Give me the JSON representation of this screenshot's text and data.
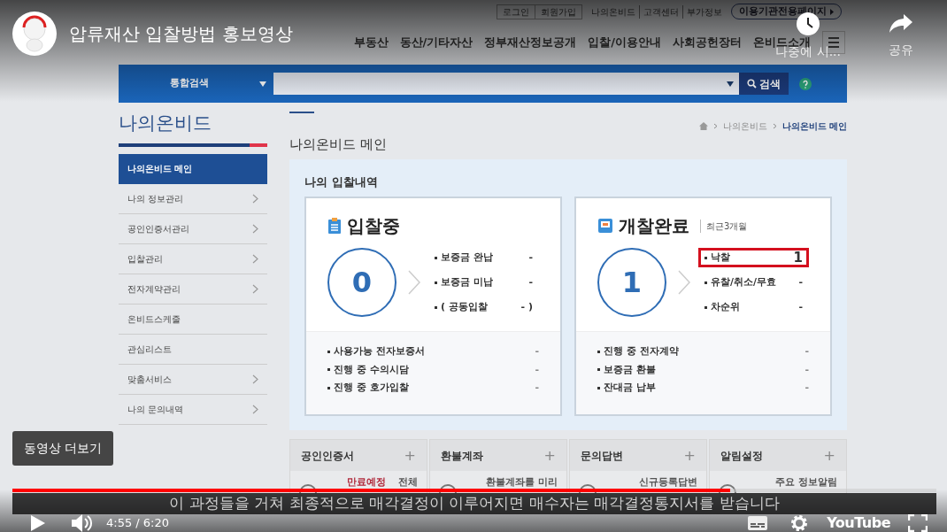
{
  "player": {
    "title": "압류재산 입찰방법 홍보영상",
    "watch_later": "나중에 시...",
    "share": "공유",
    "more_videos": "동영상 더보기",
    "paused": true,
    "progress": {
      "level": 0.777
    },
    "time": "4:55 / 6:20",
    "subtitle": "이 과정들을 거쳐 최종적으로 매각결정이 이루어지면 매수자는 매각결정통지서를 받습니다",
    "logo": "YouTube"
  },
  "site": {
    "account_links": [
      "로그인",
      "회원가입"
    ],
    "info_links": [
      "나의온비드",
      "고객센터",
      "부가정보"
    ],
    "agency_page": "이용기관전용페이지",
    "nav": [
      "부동산",
      "동산/기타자산",
      "정부재산정보공개",
      "입찰/이용안내",
      "사회공헌장터",
      "온비드소개"
    ],
    "search": {
      "category": "통합검색",
      "button": "검색"
    },
    "sidebar": {
      "title": "나의온비드",
      "items": [
        {
          "label": "나의온비드 메인",
          "selected": true,
          "expandable": false
        },
        {
          "label": "나의 정보관리",
          "selected": false,
          "expandable": true
        },
        {
          "label": "공인인증서관리",
          "selected": false,
          "expandable": true
        },
        {
          "label": "입찰관리",
          "selected": false,
          "expandable": true
        },
        {
          "label": "전자계약관리",
          "selected": false,
          "expandable": true
        },
        {
          "label": "온비드스케줄",
          "selected": false,
          "expandable": false
        },
        {
          "label": "관심리스트",
          "selected": false,
          "expandable": false
        },
        {
          "label": "맞춤서비스",
          "selected": false,
          "expandable": true
        },
        {
          "label": "나의 문의내역",
          "selected": false,
          "expandable": true
        }
      ]
    },
    "breadcrumb": [
      "나의온비드",
      "나의온비드 메인"
    ],
    "page_title": "나의온비드 메인",
    "panel_title": "나의 입찰내역",
    "cards": [
      {
        "kind": "bidding",
        "title": "입찰중",
        "count": "0",
        "rows": [
          {
            "label": "보증금 완납",
            "value": "-",
            "highlighted": false
          },
          {
            "label": "보증금 미납",
            "value": "-",
            "highlighted": false
          },
          {
            "label": "( 공동입찰",
            "value": "- )",
            "highlighted": false
          }
        ],
        "footer": [
          {
            "label": "사용가능 전자보증서",
            "value": "-"
          },
          {
            "label": "진행 중 수의시담",
            "value": "-"
          },
          {
            "label": "진행 중 호가입찰",
            "value": "-"
          }
        ]
      },
      {
        "kind": "opened",
        "title": "개찰완료",
        "note": "최근3개월",
        "count": "1",
        "rows": [
          {
            "label": "낙찰",
            "value": "1",
            "highlighted": true
          },
          {
            "label": "유찰/취소/무효",
            "value": "-",
            "highlighted": false
          },
          {
            "label": "차순위",
            "value": "-",
            "highlighted": false
          }
        ],
        "footer": [
          {
            "label": "진행 중 전자계약",
            "value": "-"
          },
          {
            "label": "보증금 환불",
            "value": "-"
          },
          {
            "label": "잔대금 납부",
            "value": "-"
          }
        ]
      }
    ],
    "quick": [
      {
        "title": "공인인증서",
        "plus": "+",
        "texts": [
          {
            "text": "만료예정",
            "color": "#b0283a"
          },
          {
            "text": "전체",
            "color": "#555555"
          }
        ]
      },
      {
        "title": "환불계좌",
        "plus": "+",
        "texts": [
          {
            "text": "환불계좌를 미리",
            "color": "#555555"
          }
        ]
      },
      {
        "title": "문의답변",
        "plus": "+",
        "texts": [
          {
            "text": "신규등록답변",
            "color": "#555555"
          }
        ]
      },
      {
        "title": "알림설정",
        "plus": "+",
        "texts": [
          {
            "text": "주요 정보알림",
            "color": "#555555"
          }
        ]
      }
    ]
  }
}
